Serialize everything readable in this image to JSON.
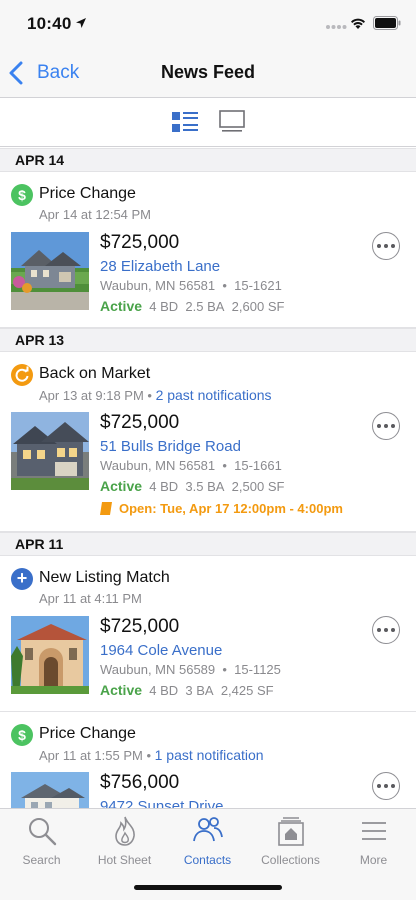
{
  "status_bar": {
    "time": "10:40",
    "icons": [
      "location-arrow-icon",
      "signal-dots-icon",
      "wifi-icon",
      "battery-icon"
    ]
  },
  "nav": {
    "back_label": "Back",
    "title": "News Feed"
  },
  "view_toggle": {
    "options": [
      "list-view-icon",
      "card-view-icon"
    ],
    "selected": "list-view-icon"
  },
  "colors": {
    "accent": "#3a6fc9",
    "active_green": "#4aa34a",
    "price_change_green": "#4cc361",
    "back_on_market_orange": "#f39a10",
    "new_listing_blue": "#3a6fc9"
  },
  "feed": {
    "groups": [
      {
        "date": "APR 14",
        "items": [
          {
            "type": "Price Change",
            "icon": "dollar-icon",
            "icon_text": "$",
            "timestamp": "Apr 14 at 12:54 PM",
            "extra_link": "",
            "listing": {
              "price": "$725,000",
              "address": "28 Elizabeth Lane",
              "city": "Waubun, MN 56581",
              "mls": "15-1621",
              "status": "Active",
              "beds": "4 BD",
              "baths": "2.5 BA",
              "sqft": "2,600 SF",
              "open_house": ""
            }
          }
        ]
      },
      {
        "date": "APR 13",
        "items": [
          {
            "type": "Back on Market",
            "icon": "refresh-icon",
            "icon_text": "",
            "timestamp": "Apr 13 at 9:18 PM",
            "extra_link": "2 past notifications",
            "listing": {
              "price": "$725,000",
              "address": "51 Bulls Bridge Road",
              "city": "Waubun, MN 56581",
              "mls": "15-1661",
              "status": "Active",
              "beds": "4 BD",
              "baths": "3.5 BA",
              "sqft": "2,500 SF",
              "open_house": "Open: Tue, Apr 17 12:00pm - 4:00pm"
            }
          }
        ]
      },
      {
        "date": "APR 11",
        "items": [
          {
            "type": "New Listing Match",
            "icon": "plus-icon",
            "icon_text": "+",
            "timestamp": "Apr 11 at 4:11 PM",
            "extra_link": "",
            "listing": {
              "price": "$725,000",
              "address": "1964 Cole Avenue",
              "city": "Waubun, MN 56589",
              "mls": "15-1125",
              "status": "Active",
              "beds": "4 BD",
              "baths": "3 BA",
              "sqft": "2,425 SF",
              "open_house": ""
            }
          },
          {
            "type": "Price Change",
            "icon": "dollar-icon",
            "icon_text": "$",
            "timestamp": "Apr 11 at 1:55 PM",
            "extra_link": "1 past notification",
            "listing": {
              "price": "$756,000",
              "address": "9472 Sunset Drive",
              "city": "",
              "mls": "",
              "status": "",
              "beds": "",
              "baths": "",
              "sqft": "",
              "open_house": ""
            }
          }
        ]
      }
    ]
  },
  "tab_bar": {
    "tabs": [
      {
        "label": "Search",
        "icon": "search-icon"
      },
      {
        "label": "Hot Sheet",
        "icon": "flame-icon"
      },
      {
        "label": "Contacts",
        "icon": "contacts-icon"
      },
      {
        "label": "Collections",
        "icon": "collections-icon"
      },
      {
        "label": "More",
        "icon": "menu-icon"
      }
    ],
    "active": "Contacts"
  }
}
